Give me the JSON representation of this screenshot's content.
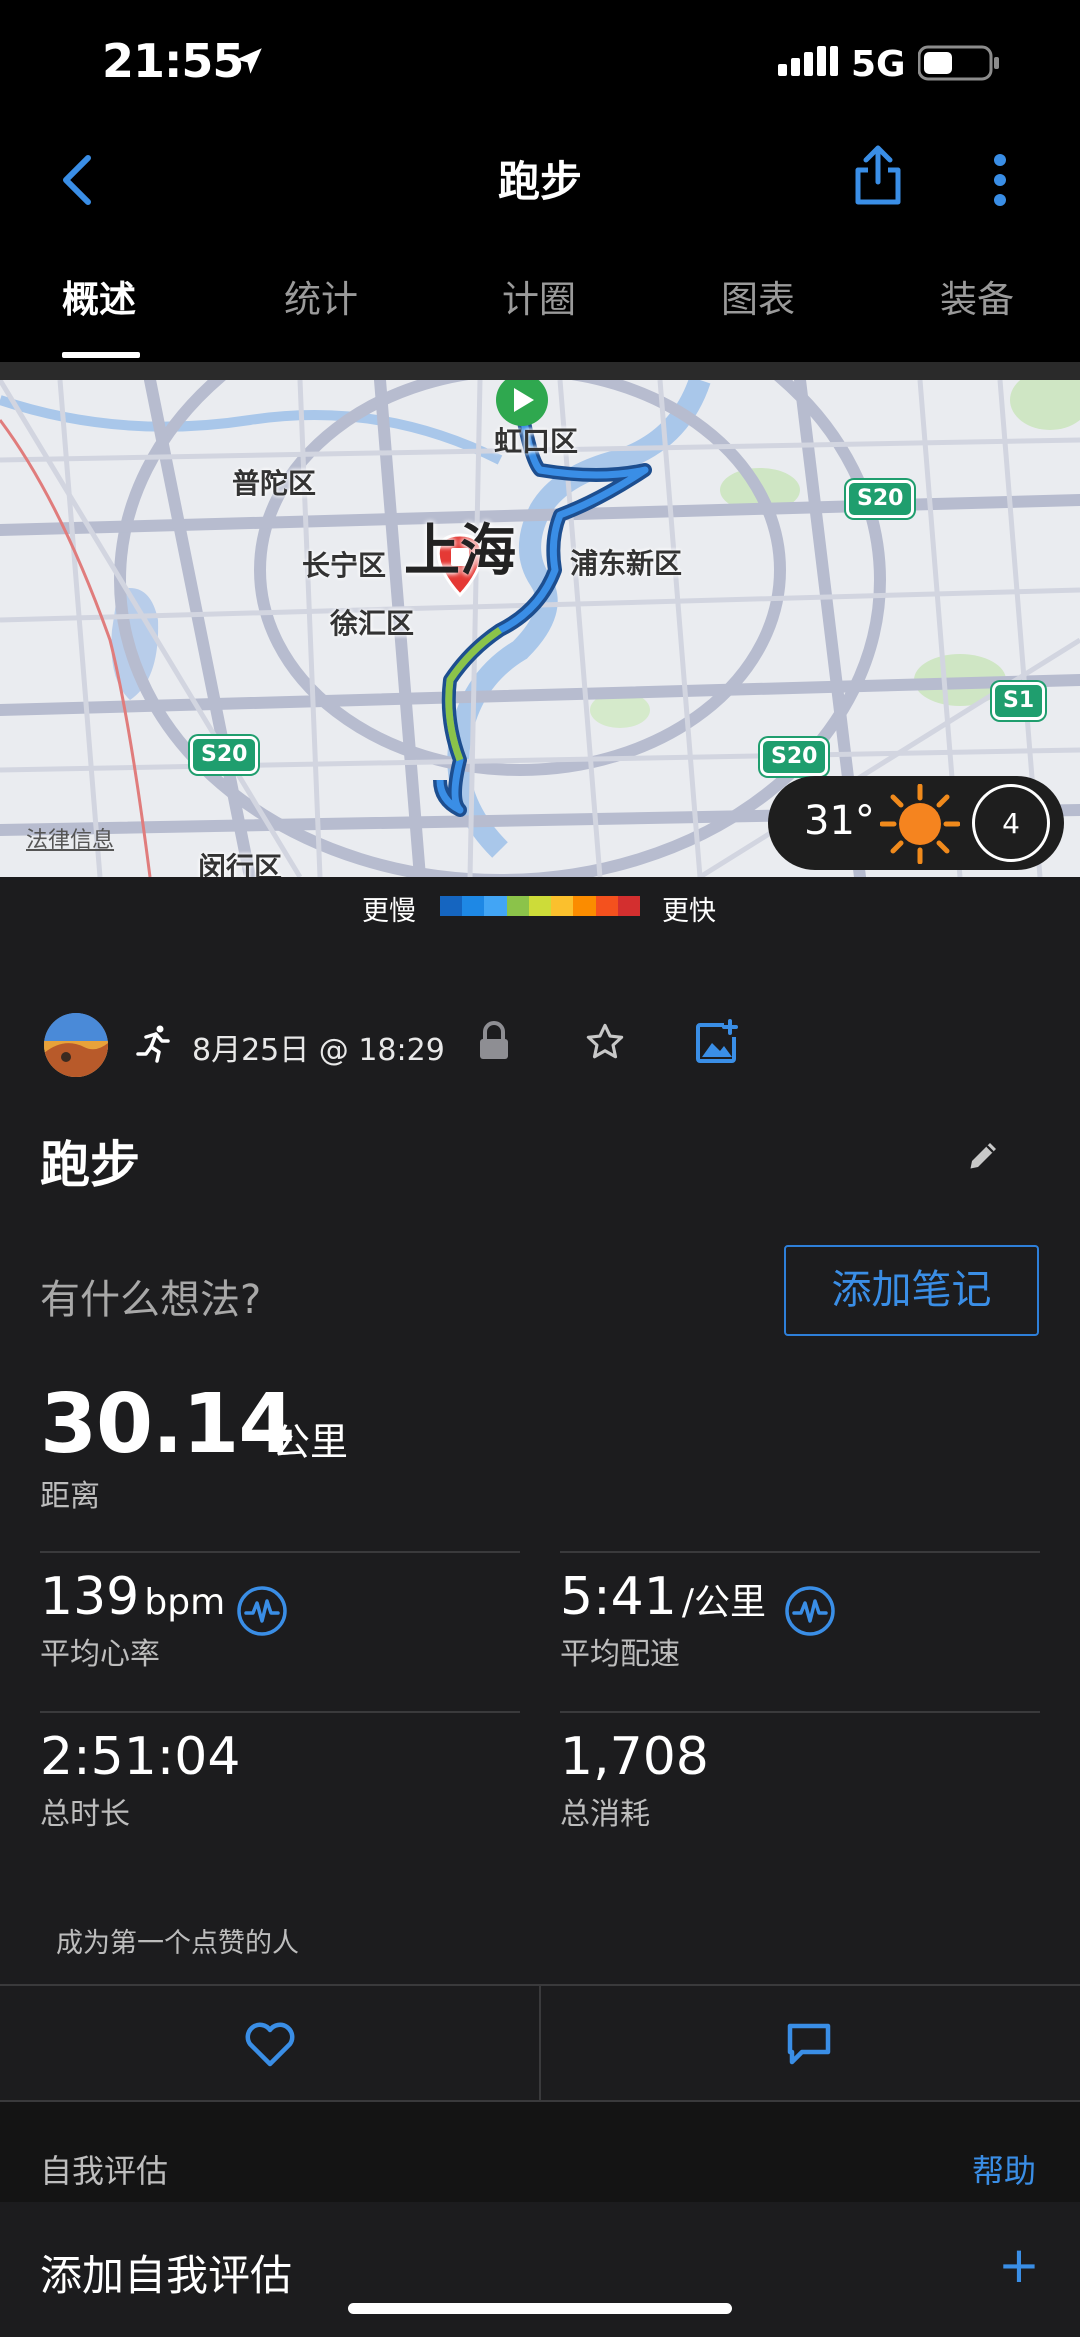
{
  "status_bar": {
    "time": "21:55",
    "network": "5G"
  },
  "header": {
    "title": "跑步",
    "icons": [
      "back-chevron-icon",
      "share-icon",
      "more-vertical-icon"
    ]
  },
  "tabs": [
    {
      "label": "概述",
      "active": true
    },
    {
      "label": "统计",
      "active": false
    },
    {
      "label": "计圈",
      "active": false
    },
    {
      "label": "图表",
      "active": false
    },
    {
      "label": "装备",
      "active": false
    }
  ],
  "map": {
    "city": "上海",
    "districts": [
      "虹口区",
      "普陀区",
      "长宁区",
      "浦东新区",
      "徐汇区",
      "闵行区"
    ],
    "road_shields": [
      "S20",
      "S20",
      "S20",
      "S1"
    ],
    "legal_link": "法律信息",
    "weather": {
      "temperature": "31°",
      "wind_speed": "4"
    }
  },
  "speed_scale": {
    "slow_label": "更慢",
    "fast_label": "更快",
    "colors": [
      "#1565c0",
      "#1e88e5",
      "#42a5f5",
      "#8bc34a",
      "#cddc39",
      "#fbc02d",
      "#fb8c00",
      "#f4511e",
      "#d32f2f"
    ]
  },
  "activity": {
    "datetime": "8月25日 @ 18:29",
    "title": "跑步",
    "thought_placeholder": "有什么想法?",
    "add_note_label": "添加笔记",
    "distance": {
      "value": "30.14",
      "unit": "公里",
      "label": "距离"
    },
    "avg_hr": {
      "value": "139",
      "unit": "bpm",
      "label": "平均心率"
    },
    "avg_pace": {
      "value": "5:41",
      "unit": "/公里",
      "label": "平均配速"
    },
    "duration": {
      "value": "2:51:04",
      "label": "总时长"
    },
    "calories": {
      "value": "1,708",
      "label": "总消耗"
    },
    "likes_text": "成为第一个点赞的人"
  },
  "self_assessment": {
    "section_label": "自我评估",
    "help_label": "帮助",
    "add_label": "添加自我评估"
  },
  "colors": {
    "accent": "#3a8ee6",
    "background": "#1c1c1e",
    "route_start": "#2fa84f",
    "route_end": "#e53935"
  }
}
